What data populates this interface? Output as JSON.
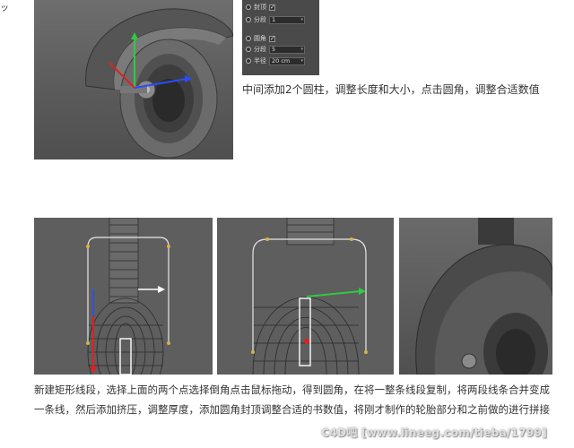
{
  "corner_glyph": "ッ",
  "settings_panel": {
    "row1_label": "封顶",
    "row2_label": "分段",
    "row2_value": "1",
    "row3_label": "圆角",
    "row4_label": "分段",
    "row4_value": "5",
    "row5_label": "半径",
    "row5_value": "20 cm"
  },
  "caption_top": "中间添加2个圆柱，调整长度和大小，点击圆角，调整合适数值",
  "paragraph": {
    "line1": "新建矩形线段，选择上面的两个点选择倒角点击鼠标拖动，得到圆角，在将一整条线段复制，将两段线条合并变成",
    "line2": "一条线，然后添加挤压，调整厚度，添加圆角封顶调整合适的书数值，将刚才制作的轮胎部分和之前做的进行拼接"
  },
  "watermark": "C4D吧 [www.lineeg.com/tieba/1799]",
  "colors": {
    "viewport_bg": "#5e5e5e",
    "axis_green": "#2ecc40",
    "axis_red": "#e02020",
    "axis_blue": "#2a4cff",
    "spline_yellow": "#e0b040"
  }
}
